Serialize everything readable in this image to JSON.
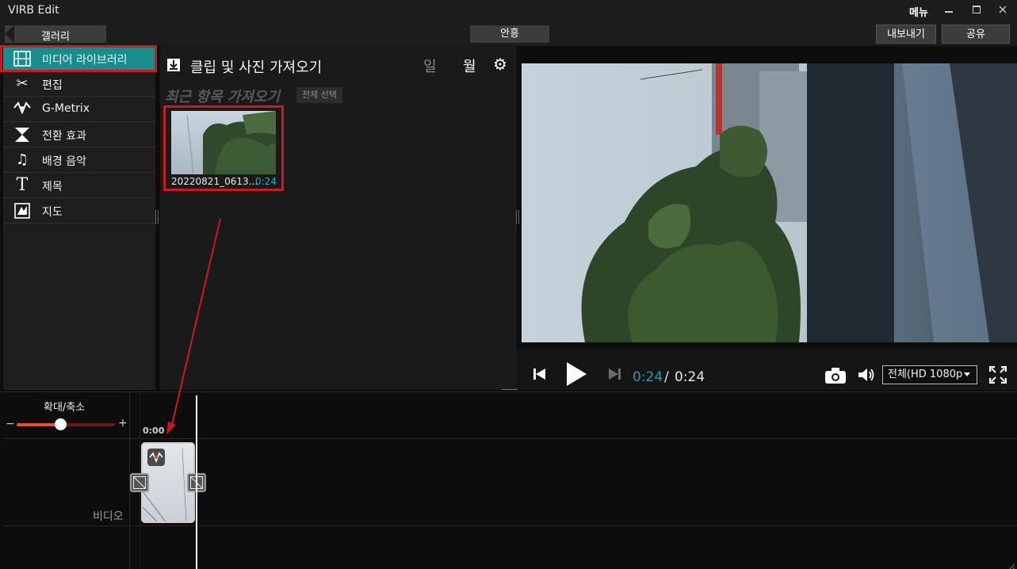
{
  "app": {
    "title": "VIRB Edit",
    "menu_label": "메뉴"
  },
  "toolbar": {
    "back_label": "갤러리",
    "center_label": "안흥",
    "export_label": "내보내기",
    "share_label": "공유"
  },
  "sidebar": {
    "items": [
      {
        "label": "미디어 라이브러리",
        "icon": "film-icon"
      },
      {
        "label": "편집",
        "icon": "scissors-icon"
      },
      {
        "label": "G-Metrix",
        "icon": "gmetrix-icon"
      },
      {
        "label": "전환 효과",
        "icon": "transition-icon"
      },
      {
        "label": "배경 음악",
        "icon": "music-note-icon"
      },
      {
        "label": "제목",
        "icon": "title-t-icon"
      },
      {
        "label": "지도",
        "icon": "map-icon"
      }
    ],
    "active_index": 0
  },
  "library": {
    "title": "클립 및 사진 가져오기",
    "view_day": "일",
    "view_month": "월",
    "recent_heading": "최근 항목 가져오기",
    "select_all": "전체 선택",
    "clips": [
      {
        "name": "20220821_0613...",
        "duration": "0:24"
      }
    ]
  },
  "player": {
    "current_time": "0:24",
    "separator": "/",
    "total_time": "0:24",
    "quality": "전체(HD 1080p"
  },
  "timeline": {
    "zoom_label": "확대/축소",
    "zoom_minus": "−",
    "zoom_plus": "+",
    "zoom_level": 0.44,
    "ruler_start": "0:00",
    "track_label": "비디오"
  },
  "colors": {
    "accent_teal": "#1b8c8c",
    "time_blue": "#2f9aa6",
    "annotation_red": "#d0181c",
    "zoom_orange": "#f14a1e"
  }
}
